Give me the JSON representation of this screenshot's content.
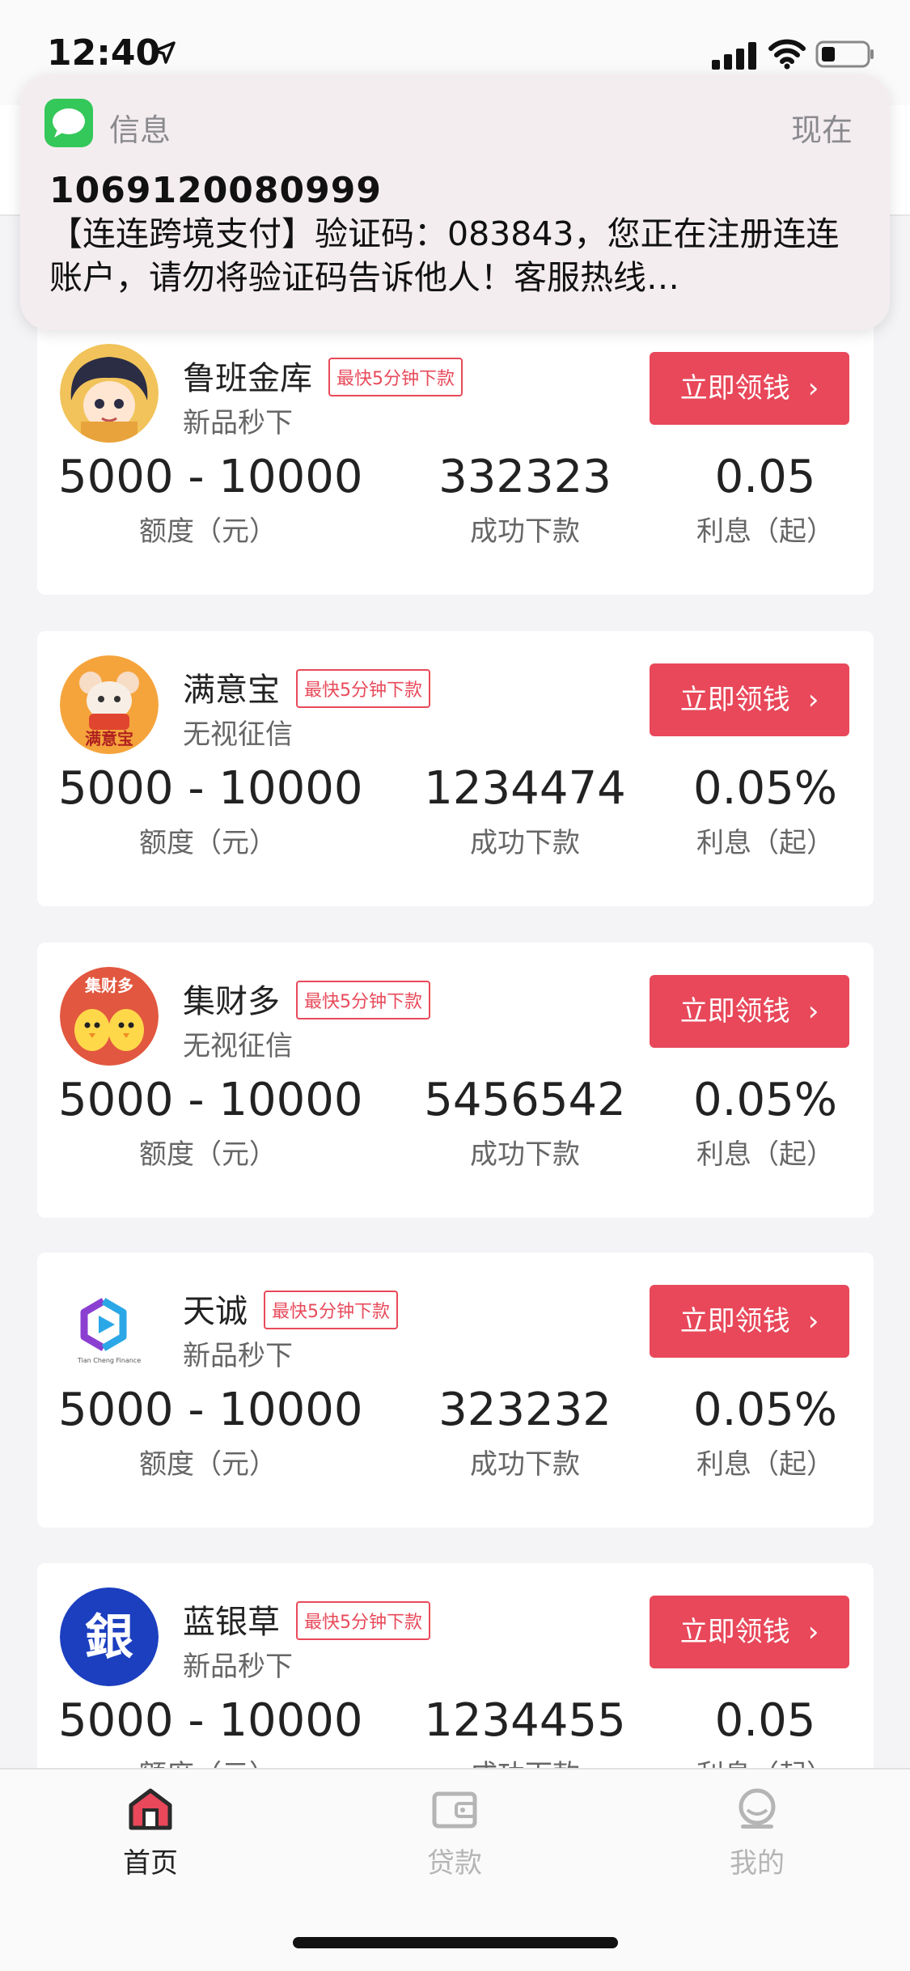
{
  "status_bar": {
    "time": "12:40"
  },
  "notification": {
    "app_name": "信息",
    "time": "现在",
    "sender": "1069120080999",
    "body": "【连连跨境支付】验证码：083843，您正在注册连连账户，请勿将验证码告诉他人！客服热线…"
  },
  "cards": [
    {
      "name": "鲁班金库",
      "badge": "最快5分钟下款",
      "subtitle": "新品秒下",
      "button": "立即领钱",
      "amount": "5000 - 10000",
      "amount_label": "额度（元）",
      "count": "332323",
      "count_label": "成功下款",
      "rate": "0.05",
      "rate_label": "利息（起）"
    },
    {
      "name": "满意宝",
      "badge": "最快5分钟下款",
      "subtitle": "无视征信",
      "button": "立即领钱",
      "amount": "5000 - 10000",
      "amount_label": "额度（元）",
      "count": "1234474",
      "count_label": "成功下款",
      "rate": "0.05%",
      "rate_label": "利息（起）",
      "logo_text": "满意宝"
    },
    {
      "name": "集财多",
      "badge": "最快5分钟下款",
      "subtitle": "无视征信",
      "button": "立即领钱",
      "amount": "5000 - 10000",
      "amount_label": "额度（元）",
      "count": "5456542",
      "count_label": "成功下款",
      "rate": "0.05%",
      "rate_label": "利息（起）",
      "logo_text": "集财多"
    },
    {
      "name": "天诚",
      "badge": "最快5分钟下款",
      "subtitle": "新品秒下",
      "button": "立即领钱",
      "amount": "5000 - 10000",
      "amount_label": "额度（元）",
      "count": "323232",
      "count_label": "成功下款",
      "rate": "0.05%",
      "rate_label": "利息（起）",
      "logo_text": "Tian Cheng Finance"
    },
    {
      "name": "蓝银草",
      "badge": "最快5分钟下款",
      "subtitle": "新品秒下",
      "button": "立即领钱",
      "amount": "5000 - 10000",
      "amount_label": "额度（元）",
      "count": "1234455",
      "count_label": "成功下款",
      "rate": "0.05",
      "rate_label": "利息（起）",
      "logo_text": "銀"
    }
  ],
  "tabs": [
    {
      "label": "首页",
      "icon": "home-icon",
      "active": true
    },
    {
      "label": "贷款",
      "icon": "wallet-icon",
      "active": false
    },
    {
      "label": "我的",
      "icon": "profile-icon",
      "active": false
    }
  ],
  "colors": {
    "accent": "#e8485a",
    "tab_active": "#222222",
    "tab_inactive": "#b5b5b5"
  }
}
